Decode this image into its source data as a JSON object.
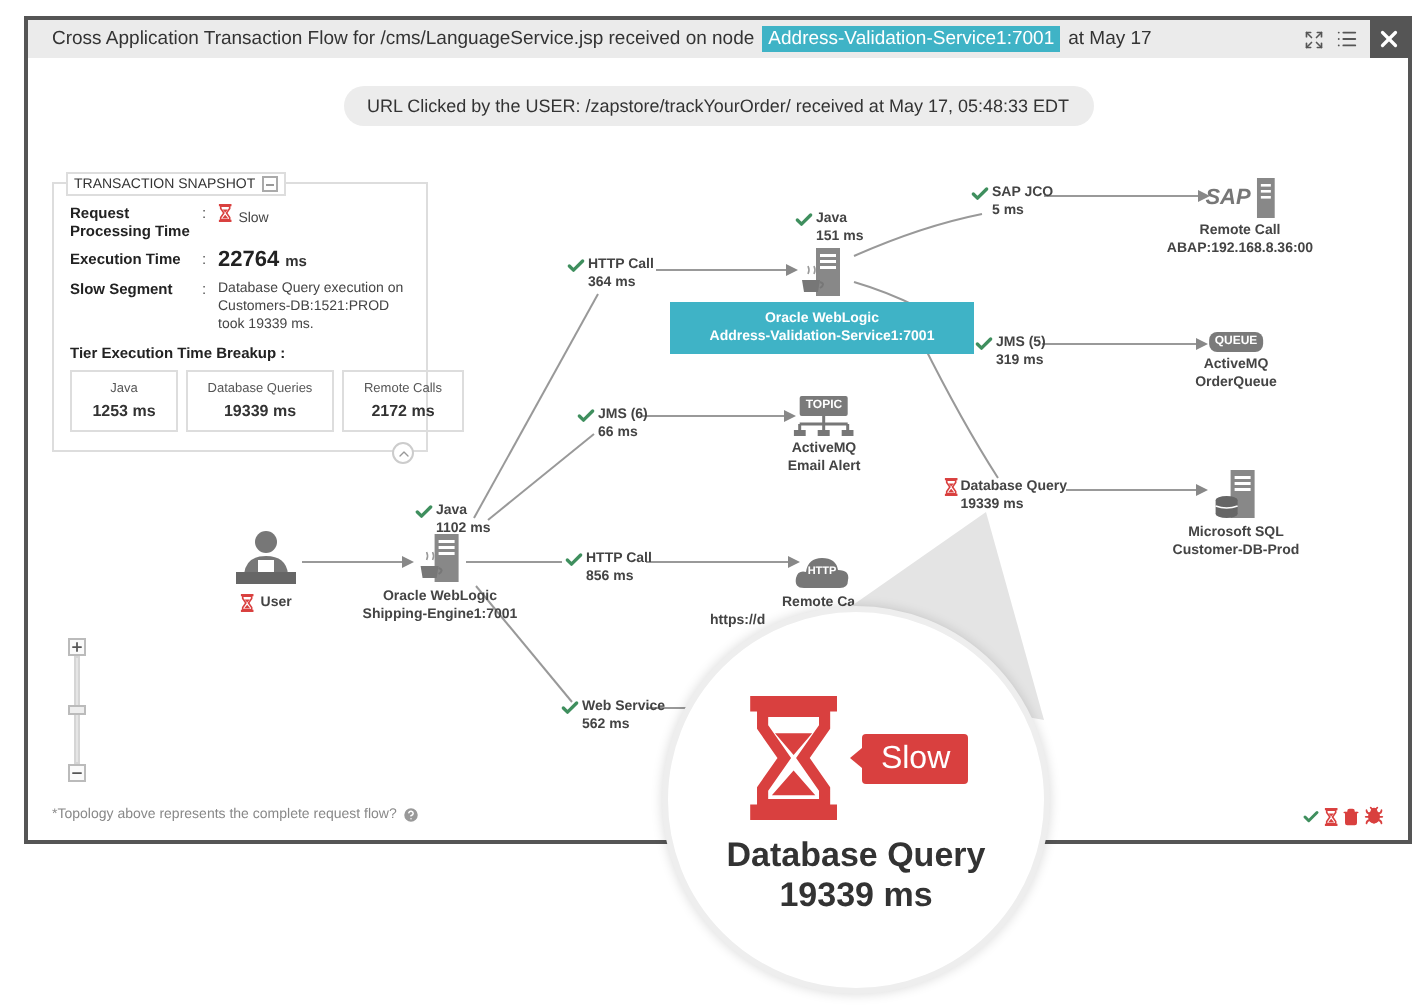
{
  "window": {
    "title_prefix": "Cross Application Transaction Flow for /cms/LanguageService.jsp received on node",
    "title_node": "Address-Validation-Service1:7001",
    "title_suffix": "at May 17"
  },
  "url_banner": "URL Clicked by the USER: /zapstore/trackYourOrder/ received at May 17,  05:48:33 EDT",
  "snapshot": {
    "title": "TRANSACTION SNAPSHOT",
    "rows": [
      {
        "kind": "status",
        "label": "Request Processing Time",
        "sep": ":",
        "value": "Slow"
      },
      {
        "kind": "big",
        "label": "Execution Time",
        "sep": ":",
        "value": "22764",
        "unit": "ms"
      },
      {
        "kind": "text",
        "label": "Slow Segment",
        "sep": ":",
        "value": "Database Query execution on Customers-DB:1521:PROD took 19339 ms."
      }
    ],
    "breakup_title": "Tier Execution Time Breakup :",
    "tiers": [
      {
        "name": "Java",
        "value": "1253 ms"
      },
      {
        "name": "Database Queries",
        "value": "19339 ms"
      },
      {
        "name": "Remote Calls",
        "value": "2172 ms"
      }
    ]
  },
  "nodes": [
    {
      "kind": "user",
      "slow": true,
      "selected": false,
      "lines": [
        "User"
      ]
    },
    {
      "kind": "server",
      "selected": false,
      "lines": [
        "Oracle WebLogic",
        "Shipping-Engine1:7001"
      ]
    },
    {
      "kind": "server",
      "selected": true,
      "lines": [
        "Oracle WebLogic",
        "Address-Validation-Service1:7001"
      ]
    },
    {
      "kind": "topic",
      "icon_text": "TOPIC",
      "selected": false,
      "lines": [
        "ActiveMQ",
        "Email Alert"
      ]
    },
    {
      "kind": "sap",
      "icon_text": "SAP",
      "selected": false,
      "lines": [
        "Remote Call",
        "ABAP:192.168.8.36:00"
      ]
    },
    {
      "kind": "queue",
      "icon_text": "QUEUE",
      "selected": false,
      "lines": [
        "ActiveMQ",
        "OrderQueue"
      ]
    },
    {
      "kind": "database",
      "selected": false,
      "lines": [
        "Microsoft SQL",
        "Customer-DB-Prod"
      ]
    },
    {
      "kind": "cloud",
      "icon_text": "HTTP",
      "selected": false,
      "lines": [
        "Remote Ca",
        "https://d"
      ]
    }
  ],
  "calls": [
    {
      "slow": false,
      "name": "Java",
      "time": "1102 ms"
    },
    {
      "slow": false,
      "name": "HTTP Call",
      "time": "364 ms"
    },
    {
      "slow": false,
      "name": "Java",
      "time": "151 ms"
    },
    {
      "slow": false,
      "name": "JMS (6)",
      "time": "66 ms"
    },
    {
      "slow": false,
      "name": "SAP JCO",
      "time": "5 ms"
    },
    {
      "slow": false,
      "name": "JMS (5)",
      "time": "319 ms"
    },
    {
      "slow": true,
      "name": "Database Query",
      "time": "19339 ms"
    },
    {
      "slow": false,
      "name": "HTTP Call",
      "time": "856 ms"
    },
    {
      "slow": false,
      "name": "Web Service",
      "time": "562 ms"
    }
  ],
  "zoom": {
    "level": 0.5
  },
  "footnote": "*Topology above represents the complete request flow?",
  "magnifier": {
    "badge": "Slow",
    "name": "Database Query",
    "time": "19339 ms"
  }
}
